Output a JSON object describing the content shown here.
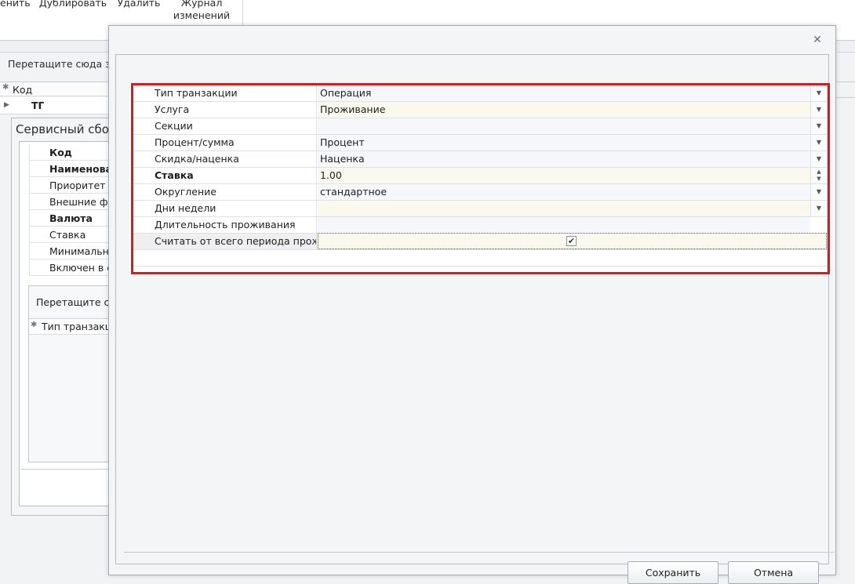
{
  "toolbar": {
    "items": [
      "енить",
      "Дублировать",
      "Удалить"
    ],
    "journal_line1": "Журнал",
    "journal_line2": "изменений"
  },
  "background": {
    "group_label": "Перетащите сюда за",
    "grid_header": "Код",
    "grid_row_code": "ТГ",
    "service_title": "Сервисный сбор(",
    "fields": [
      {
        "label": "Код",
        "bold": true
      },
      {
        "label": "Наименова",
        "bold": true
      },
      {
        "label": "Приоритет",
        "bold": false
      },
      {
        "label": "Внешние фун",
        "bold": false
      },
      {
        "label": "Валюта",
        "bold": true
      },
      {
        "label": "Ставка",
        "bold": false
      },
      {
        "label": "Минимальная",
        "bold": false
      },
      {
        "label": "Включен в с",
        "bold": false
      }
    ],
    "sub_group_label": "Перетащите сюд",
    "sub_header": "Тип транзакци"
  },
  "dialog": {
    "properties": [
      {
        "label": "Тип транзакции",
        "value": "Операция",
        "editor": "dropdown",
        "bold": false
      },
      {
        "label": "Услуга",
        "value": "Проживание",
        "editor": "dropdown",
        "bold": false
      },
      {
        "label": "Секции",
        "value": "",
        "editor": "dropdown",
        "bold": false
      },
      {
        "label": "Процент/сумма",
        "value": "Процент",
        "editor": "dropdown",
        "bold": false
      },
      {
        "label": "Скидка/наценка",
        "value": "Наценка",
        "editor": "dropdown",
        "bold": false
      },
      {
        "label": "Ставка",
        "value": "1.00",
        "editor": "spin",
        "bold": true
      },
      {
        "label": "Округление",
        "value": "стандартное",
        "editor": "dropdown",
        "bold": false
      },
      {
        "label": "Дни недели",
        "value": "",
        "editor": "dropdown",
        "bold": false
      },
      {
        "label": "Длительность проживания",
        "value": "",
        "editor": "text",
        "bold": false
      },
      {
        "label": "Считать от всего периода прожив",
        "value": "",
        "editor": "checkbox",
        "checked": true,
        "bold": false
      }
    ],
    "save_label": "Сохранить",
    "cancel_label": "Отмена"
  },
  "colors": {
    "highlight": "#e01818",
    "value_tint": "#fbf8ee"
  }
}
